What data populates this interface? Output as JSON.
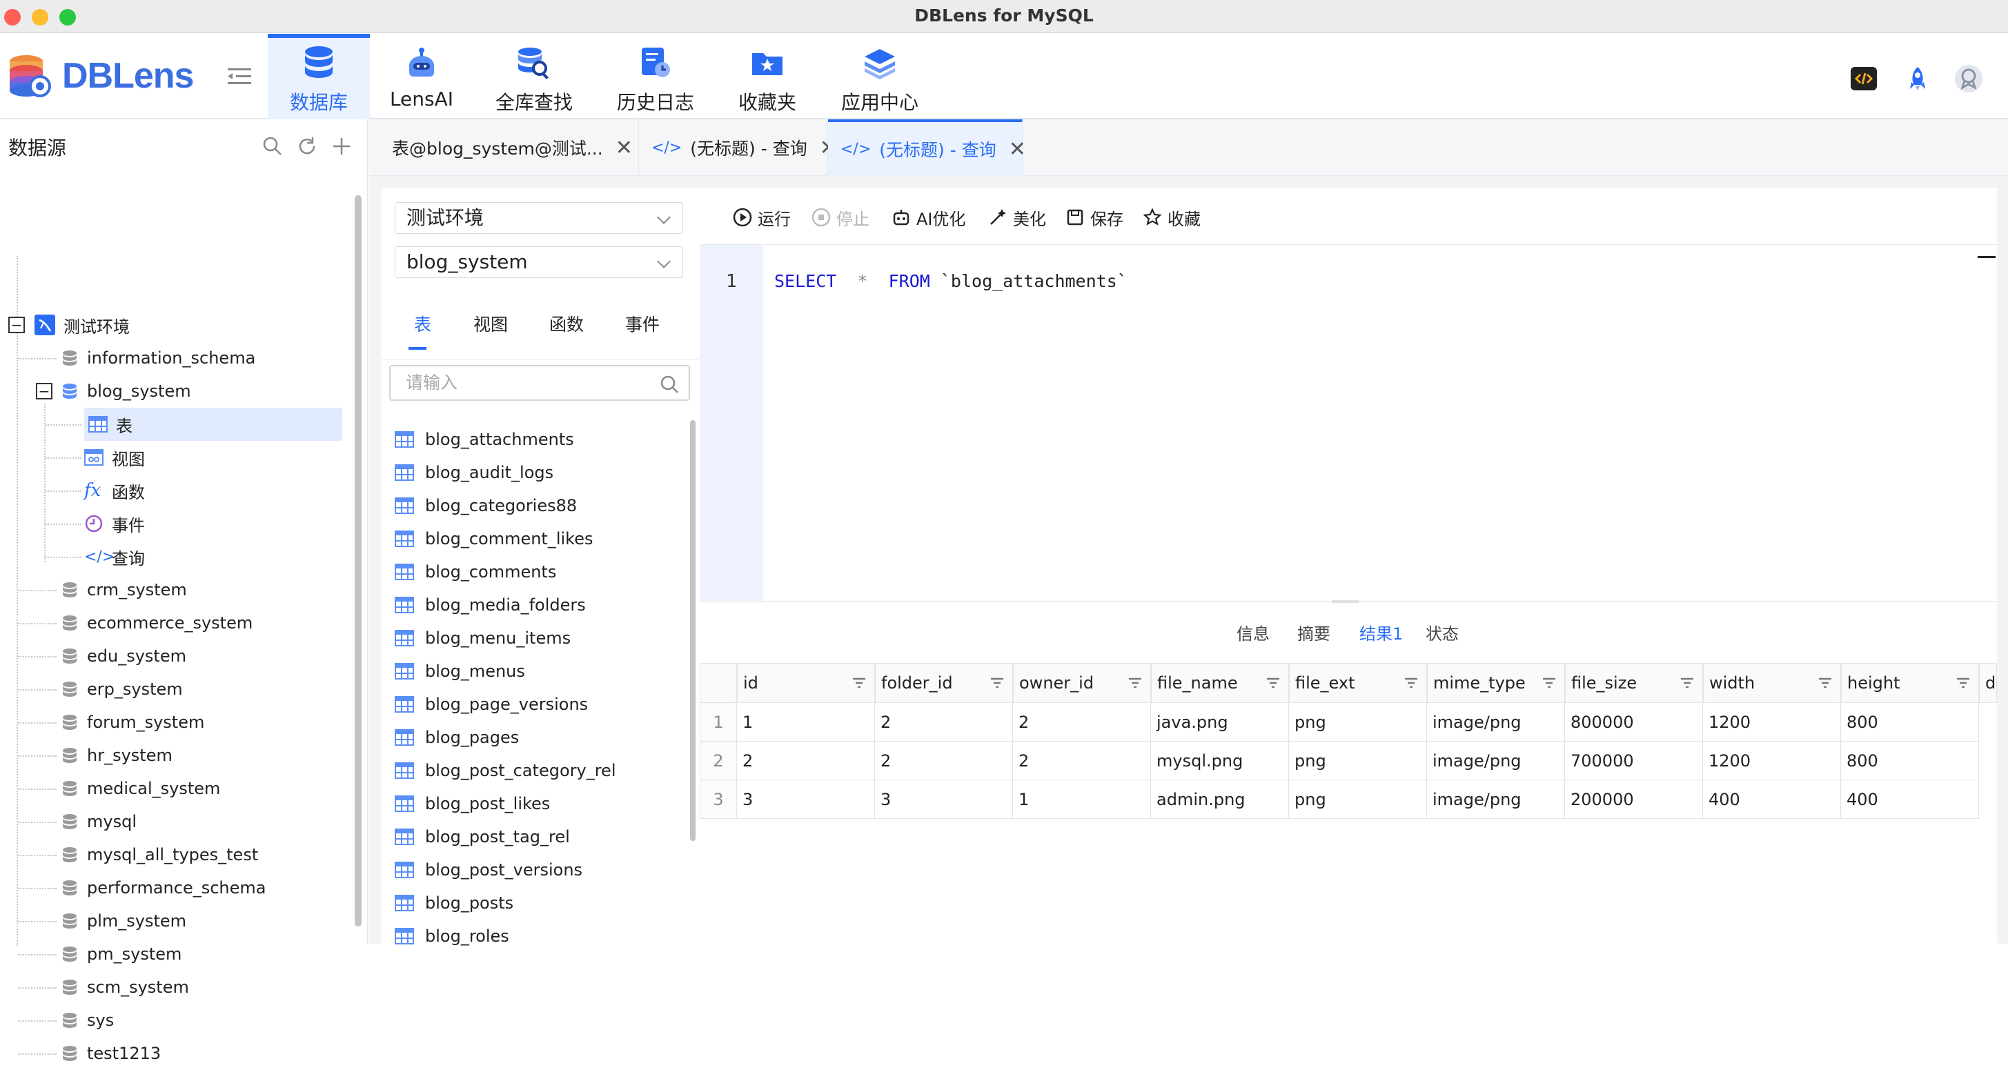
{
  "window": {
    "title": "DBLens for MySQL"
  },
  "brand": {
    "name": "DBLens"
  },
  "nav": [
    {
      "label": "数据库",
      "icon": "database-stack-icon",
      "active": true
    },
    {
      "label": "LensAI",
      "icon": "ai-robot-icon"
    },
    {
      "label": "全库查找",
      "icon": "database-search-icon"
    },
    {
      "label": "历史日志",
      "icon": "history-log-icon"
    },
    {
      "label": "收藏夹",
      "icon": "favorites-folder-icon"
    },
    {
      "label": "应用中心",
      "icon": "app-layers-icon"
    }
  ],
  "sidebar": {
    "title": "数据源",
    "env": "测试环境",
    "databases_top": [
      "information_schema",
      "blog_system"
    ],
    "blog_children": [
      "表",
      "视图",
      "函数",
      "事件",
      "查询"
    ],
    "databases_rest": [
      "crm_system",
      "ecommerce_system",
      "edu_system",
      "erp_system",
      "forum_system",
      "hr_system",
      "medical_system",
      "mysql",
      "mysql_all_types_test",
      "performance_schema",
      "plm_system",
      "pm_system",
      "scm_system",
      "sys",
      "test1213"
    ]
  },
  "tabs": [
    {
      "label": "表@blog_system@测试...",
      "icon": "table-icon"
    },
    {
      "label": "(无标题) - 查询",
      "icon": "code-icon"
    },
    {
      "label": "(无标题) - 查询",
      "icon": "code-icon",
      "active": true
    }
  ],
  "object_panel": {
    "env_select": "测试环境",
    "db_select": "blog_system",
    "tabs": [
      "表",
      "视图",
      "函数",
      "事件"
    ],
    "search_placeholder": "请输入",
    "tables": [
      "blog_attachments",
      "blog_audit_logs",
      "blog_categories88",
      "blog_comment_likes",
      "blog_comments",
      "blog_media_folders",
      "blog_menu_items",
      "blog_menus",
      "blog_page_versions",
      "blog_pages",
      "blog_post_category_rel",
      "blog_post_likes",
      "blog_post_tag_rel",
      "blog_post_versions",
      "blog_posts",
      "blog_roles"
    ]
  },
  "toolbar": {
    "run": "运行",
    "stop": "停止",
    "ai": "AI优化",
    "beautify": "美化",
    "save": "保存",
    "favorite": "收藏"
  },
  "editor": {
    "line": "1",
    "kw1": "SELECT",
    "star": "*",
    "kw2": "FROM",
    "table": "`blog_attachments`"
  },
  "result_tabs": [
    "信息",
    "摘要",
    "结果1",
    "状态"
  ],
  "grid": {
    "columns": [
      "id",
      "folder_id",
      "owner_id",
      "file_name",
      "file_ext",
      "mime_type",
      "file_size",
      "width",
      "height",
      "d"
    ],
    "rows": [
      [
        "1",
        "1",
        "2",
        "2",
        "java.png",
        "png",
        "image/png",
        "800000",
        "1200",
        "800"
      ],
      [
        "2",
        "2",
        "2",
        "2",
        "mysql.png",
        "png",
        "image/png",
        "700000",
        "1200",
        "800"
      ],
      [
        "3",
        "3",
        "3",
        "1",
        "admin.png",
        "png",
        "image/png",
        "200000",
        "400",
        "400"
      ]
    ]
  },
  "colors": {
    "accent": "#2a6df4",
    "active_bg": "#eaf1ff"
  }
}
